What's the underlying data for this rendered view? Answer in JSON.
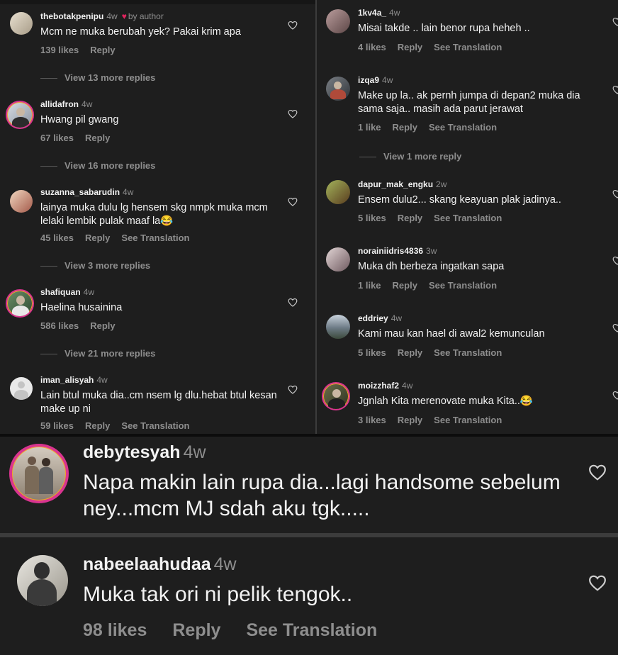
{
  "left_column": {
    "comments": [
      {
        "username": "thebotakpenipu",
        "time": "4w",
        "author_badge": "by author",
        "text": "Mcm ne muka berubah yek? Pakai krim apa",
        "likes": "139 likes",
        "reply": "Reply"
      },
      {
        "username": "allidafron",
        "time": "4w",
        "text": "Hwang pil gwang",
        "likes": "67 likes",
        "reply": "Reply"
      },
      {
        "username": "suzanna_sabarudin",
        "time": "4w",
        "text": "lainya muka dulu lg hensem skg nmpk muka mcm lelaki lembik pulak maaf la😂",
        "likes": "45 likes",
        "reply": "Reply",
        "translation": "See Translation"
      },
      {
        "username": "shafiquan",
        "time": "4w",
        "text": "Haelina husainina",
        "likes": "586 likes",
        "reply": "Reply"
      },
      {
        "username": "iman_alisyah",
        "time": "4w",
        "text": "Lain btul muka dia..cm nsem lg dlu.hebat btul kesan make up ni",
        "likes": "59 likes",
        "reply": "Reply",
        "translation": "See Translation"
      }
    ],
    "view_more": [
      "View 13 more replies",
      "View 16 more replies",
      "View 3 more replies",
      "View 21 more replies"
    ]
  },
  "right_column": {
    "comments": [
      {
        "username": "1kv4a_",
        "time": "4w",
        "text": "Misai takde .. lain benor rupa heheh ..",
        "likes": "4 likes",
        "reply": "Reply",
        "translation": "See Translation"
      },
      {
        "username": "izqa9",
        "time": "4w",
        "text": "Make up la.. ak pernh jumpa di depan2 muka dia sama saja.. masih ada parut jerawat",
        "likes": "1 like",
        "reply": "Reply",
        "translation": "See Translation"
      },
      {
        "username": "dapur_mak_engku",
        "time": "2w",
        "text": "Ensem dulu2... skang keayuan plak jadinya..",
        "likes": "5 likes",
        "reply": "Reply",
        "translation": "See Translation"
      },
      {
        "username": "norainiidris4836",
        "time": "3w",
        "text": "Muka dh berbeza ingatkan sapa",
        "likes": "1 like",
        "reply": "Reply",
        "translation": "See Translation"
      },
      {
        "username": "eddriey",
        "time": "4w",
        "text": "Kami mau kan hael di awal2 kemunculan",
        "likes": "5 likes",
        "reply": "Reply",
        "translation": "See Translation"
      },
      {
        "username": "moizzhaf2",
        "time": "4w",
        "text": "Jgnlah Kita merenovate muka Kita..😂",
        "likes": "3 likes",
        "reply": "Reply",
        "translation": "See Translation"
      }
    ],
    "view_more": [
      "View 1 more reply"
    ]
  },
  "bottom": {
    "comments": [
      {
        "username": "debytesyah",
        "time": "4w",
        "text": "Napa makin lain rupa dia...lagi handsome sebelum ney...mcm MJ sdah aku tgk....."
      },
      {
        "username": "nabeelaahudaa",
        "time": "4w",
        "text": "Muka tak ori ni pelik tengok..",
        "likes": "98 likes",
        "reply": "Reply",
        "translation": "See Translation"
      }
    ]
  },
  "icons": {
    "like": "heart-outline-icon",
    "author_like": "heart-filled-icon"
  },
  "colors": {
    "background": "#1e1e1e",
    "text": "#f2f2f2",
    "secondary": "#8e8e8e",
    "story_ring": "#d9348f",
    "author_heart": "#e0245e"
  }
}
